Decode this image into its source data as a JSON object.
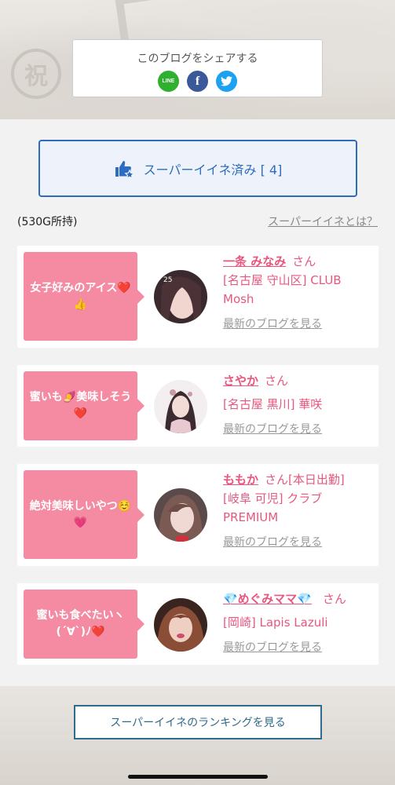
{
  "share": {
    "title": "このブログをシェアする",
    "icons": [
      {
        "name": "line-icon",
        "label": "LINE",
        "color": "#2fb02f"
      },
      {
        "name": "facebook-icon",
        "label": "f",
        "color": "#3b5998"
      },
      {
        "name": "twitter-icon",
        "label": "",
        "color": "#1da1f2"
      }
    ]
  },
  "super_like": {
    "label": "スーパーイイネ済み [ 4]",
    "accent": "#2d6cc0"
  },
  "points": "(530G所持)",
  "what_link": "スーパーイイネとは？",
  "likes": [
    {
      "comment": "女子好みのアイス❤️👍",
      "name": "一条 みなみ",
      "san": "さん",
      "shop": "[名古屋 守山区] CLUB Mosh",
      "latest": "最新のブログを見る",
      "avatar_badge": "25"
    },
    {
      "comment": "蜜いも🍠美味しそう❤️",
      "name": "さやか",
      "san": "さん",
      "shop": "[名古屋 黒川] 華咲",
      "latest": "最新のブログを見る"
    },
    {
      "comment": "絶対美味しいやつ☺️💗",
      "name": "ももか",
      "san": "さん[本日出勤]",
      "shop": "[岐阜 可児] クラブ PREMIUM",
      "latest": "最新のブログを見る"
    },
    {
      "comment": "蜜いも食べたいヽ(´∀`)ﾉ❤️",
      "name": "💎めぐみママ💎",
      "san": "さん",
      "shop": "[岡崎] Lapis Lazuli",
      "latest": "最新のブログを見る"
    }
  ],
  "ranking_button": "スーパーイイネのランキングを見る",
  "colors": {
    "pink": "#f48ba3",
    "name_pink": "#e8577e",
    "ranking_border": "#2f6b8a"
  }
}
